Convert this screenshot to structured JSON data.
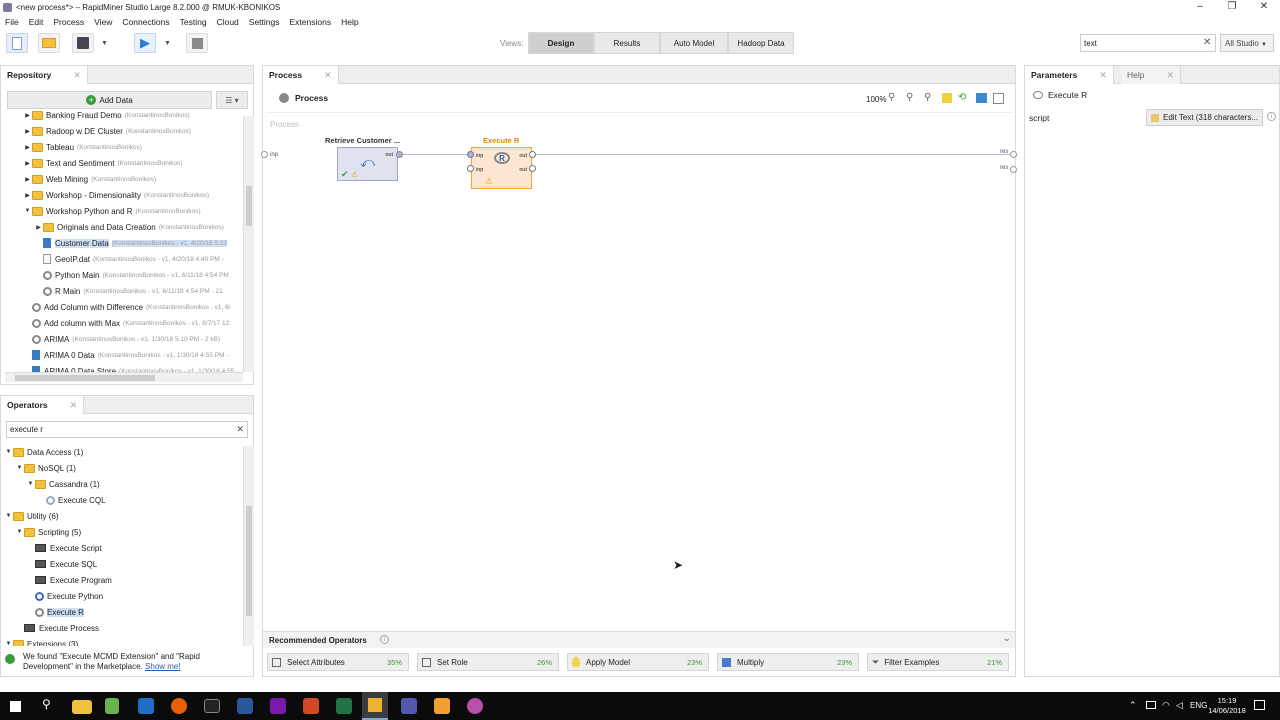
{
  "window": {
    "title": "<new process*> – RapidMiner Studio Large 8.2.000 @ RMUK-KBONIKOS"
  },
  "menu": [
    "File",
    "Edit",
    "Process",
    "View",
    "Connections",
    "Testing",
    "Cloud",
    "Settings",
    "Extensions",
    "Help"
  ],
  "views": {
    "label": "Views:",
    "items": [
      "Design",
      "Results",
      "Auto Model",
      "Hadoop Data"
    ],
    "active": "Design"
  },
  "global_search": {
    "value": "text",
    "scope": "All Studio"
  },
  "repository": {
    "tab": "Repository",
    "add_data": "Add Data",
    "items": [
      {
        "label": "Banking Fraud Demo",
        "meta": "(KonstantinosBonikos)"
      },
      {
        "label": "Radoop w DE Cluster",
        "meta": "(KonstantinosBonikos)"
      },
      {
        "label": "Tableau",
        "meta": "(KonstantinosBonikos)"
      },
      {
        "label": "Text and Sentiment",
        "meta": "(KonstantinosBonikos)"
      },
      {
        "label": "Web Mining",
        "meta": "(KonstantinosBonikos)"
      },
      {
        "label": "Workshop - Dimensionality",
        "meta": "(KonstantinosBonikos)"
      },
      {
        "label": "Workshop Python and R",
        "meta": "(KonstantinosBonikos)"
      },
      {
        "label": "Originals and Data Creation",
        "meta": "(KonstantinosBonikos)"
      },
      {
        "label": "Customer Data",
        "meta": "(KonstantinosBonikos - v1, 4/20/18 5:23"
      },
      {
        "label": "GeoIP.dat",
        "meta": "(KonstantinosBonikos - v1, 4/20/18 4:40 PM -"
      },
      {
        "label": "Python Main",
        "meta": "(KonstantinosBonikos - v1, 6/11/18 4:54 PM"
      },
      {
        "label": "R Main",
        "meta": "(KonstantinosBonikos - v1, 6/11/18 4:54 PM - 21"
      },
      {
        "label": "Add Column with Difference",
        "meta": "(KonstantinosBonikos - v1, 6/"
      },
      {
        "label": "Add column with Max",
        "meta": "(KonstantinosBonikos - v1, 8/7/17 12:"
      },
      {
        "label": "ARIMA",
        "meta": "(KonstantinosBonikos - v1, 1/30/18 5:10 PM - 2 kB)"
      },
      {
        "label": "ARIMA 0 Data",
        "meta": "(KonstantinosBonikos - v1, 1/30/18 4:55 PM -"
      },
      {
        "label": "ARIMA 0 Data Store",
        "meta": "(KonstantinosBonikos - v1, 1/30/18 4:55"
      }
    ]
  },
  "operators": {
    "tab": "Operators",
    "search": "execute r",
    "items": [
      {
        "label": "Data Access (1)"
      },
      {
        "label": "NoSQL (1)"
      },
      {
        "label": "Cassandra (1)"
      },
      {
        "label": "Execute CQL"
      },
      {
        "label": "Utility (6)"
      },
      {
        "label": "Scripting (5)"
      },
      {
        "label": "Execute Script"
      },
      {
        "label": "Execute SQL"
      },
      {
        "label": "Execute Program"
      },
      {
        "label": "Execute Python"
      },
      {
        "label": "Execute R"
      },
      {
        "label": "Execute Process"
      },
      {
        "label": "Extensions (3)"
      }
    ],
    "notice": "We found \"Execute MCMD Extension\" and \"Rapid Development\" in the Marketplace.",
    "notice_link": "Show me!"
  },
  "process": {
    "tab": "Process",
    "breadcrumb": "Process",
    "zoom": "100%",
    "canvas_label": "Process",
    "ports": {
      "inp": "inp",
      "res": "res"
    },
    "op1": {
      "title": "Retrieve Customer ...",
      "out": "out"
    },
    "op2": {
      "title": "Execute R",
      "inp": "inp",
      "out": "out"
    }
  },
  "recommended": {
    "title": "Recommended Operators",
    "items": [
      {
        "label": "Select Attributes",
        "pct": "35%"
      },
      {
        "label": "Set Role",
        "pct": "26%"
      },
      {
        "label": "Apply Model",
        "pct": "23%"
      },
      {
        "label": "Multiply",
        "pct": "23%"
      },
      {
        "label": "Filter Examples",
        "pct": "21%"
      }
    ]
  },
  "parameters": {
    "tab": "Parameters",
    "help_tab": "Help",
    "operator": "Execute R",
    "param_name": "script",
    "param_button": "Edit Text (318 characters..."
  },
  "taskbar": {
    "lang": "ENG",
    "time": "15:19",
    "date": "14/06/2018"
  },
  "colors": {
    "accent": "#3a9ad9",
    "op_highlight": "#f5a623",
    "green": "#3a9a3a"
  }
}
